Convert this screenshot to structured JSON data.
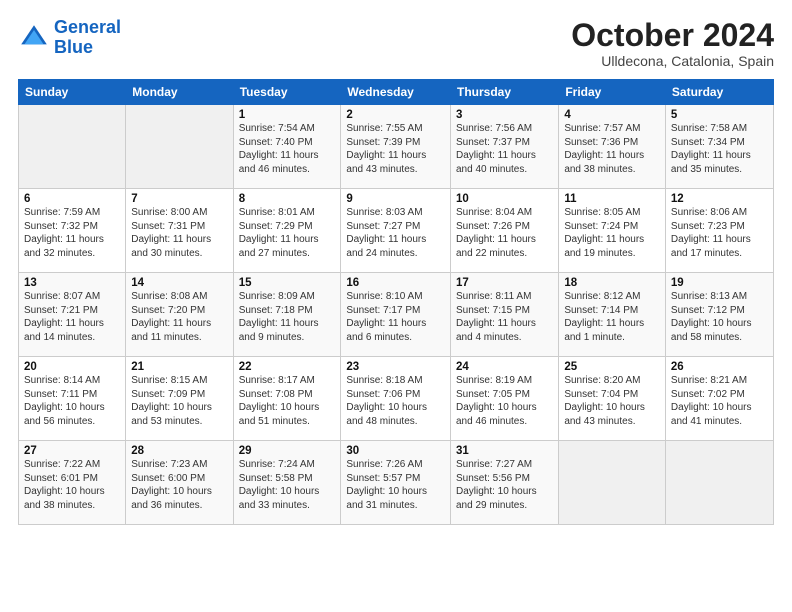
{
  "logo": {
    "line1": "General",
    "line2": "Blue"
  },
  "title": "October 2024",
  "location": "Ulldecona, Catalonia, Spain",
  "days_of_week": [
    "Sunday",
    "Monday",
    "Tuesday",
    "Wednesday",
    "Thursday",
    "Friday",
    "Saturday"
  ],
  "weeks": [
    [
      {
        "num": "",
        "detail": ""
      },
      {
        "num": "",
        "detail": ""
      },
      {
        "num": "1",
        "detail": "Sunrise: 7:54 AM\nSunset: 7:40 PM\nDaylight: 11 hours and 46 minutes."
      },
      {
        "num": "2",
        "detail": "Sunrise: 7:55 AM\nSunset: 7:39 PM\nDaylight: 11 hours and 43 minutes."
      },
      {
        "num": "3",
        "detail": "Sunrise: 7:56 AM\nSunset: 7:37 PM\nDaylight: 11 hours and 40 minutes."
      },
      {
        "num": "4",
        "detail": "Sunrise: 7:57 AM\nSunset: 7:36 PM\nDaylight: 11 hours and 38 minutes."
      },
      {
        "num": "5",
        "detail": "Sunrise: 7:58 AM\nSunset: 7:34 PM\nDaylight: 11 hours and 35 minutes."
      }
    ],
    [
      {
        "num": "6",
        "detail": "Sunrise: 7:59 AM\nSunset: 7:32 PM\nDaylight: 11 hours and 32 minutes."
      },
      {
        "num": "7",
        "detail": "Sunrise: 8:00 AM\nSunset: 7:31 PM\nDaylight: 11 hours and 30 minutes."
      },
      {
        "num": "8",
        "detail": "Sunrise: 8:01 AM\nSunset: 7:29 PM\nDaylight: 11 hours and 27 minutes."
      },
      {
        "num": "9",
        "detail": "Sunrise: 8:03 AM\nSunset: 7:27 PM\nDaylight: 11 hours and 24 minutes."
      },
      {
        "num": "10",
        "detail": "Sunrise: 8:04 AM\nSunset: 7:26 PM\nDaylight: 11 hours and 22 minutes."
      },
      {
        "num": "11",
        "detail": "Sunrise: 8:05 AM\nSunset: 7:24 PM\nDaylight: 11 hours and 19 minutes."
      },
      {
        "num": "12",
        "detail": "Sunrise: 8:06 AM\nSunset: 7:23 PM\nDaylight: 11 hours and 17 minutes."
      }
    ],
    [
      {
        "num": "13",
        "detail": "Sunrise: 8:07 AM\nSunset: 7:21 PM\nDaylight: 11 hours and 14 minutes."
      },
      {
        "num": "14",
        "detail": "Sunrise: 8:08 AM\nSunset: 7:20 PM\nDaylight: 11 hours and 11 minutes."
      },
      {
        "num": "15",
        "detail": "Sunrise: 8:09 AM\nSunset: 7:18 PM\nDaylight: 11 hours and 9 minutes."
      },
      {
        "num": "16",
        "detail": "Sunrise: 8:10 AM\nSunset: 7:17 PM\nDaylight: 11 hours and 6 minutes."
      },
      {
        "num": "17",
        "detail": "Sunrise: 8:11 AM\nSunset: 7:15 PM\nDaylight: 11 hours and 4 minutes."
      },
      {
        "num": "18",
        "detail": "Sunrise: 8:12 AM\nSunset: 7:14 PM\nDaylight: 11 hours and 1 minute."
      },
      {
        "num": "19",
        "detail": "Sunrise: 8:13 AM\nSunset: 7:12 PM\nDaylight: 10 hours and 58 minutes."
      }
    ],
    [
      {
        "num": "20",
        "detail": "Sunrise: 8:14 AM\nSunset: 7:11 PM\nDaylight: 10 hours and 56 minutes."
      },
      {
        "num": "21",
        "detail": "Sunrise: 8:15 AM\nSunset: 7:09 PM\nDaylight: 10 hours and 53 minutes."
      },
      {
        "num": "22",
        "detail": "Sunrise: 8:17 AM\nSunset: 7:08 PM\nDaylight: 10 hours and 51 minutes."
      },
      {
        "num": "23",
        "detail": "Sunrise: 8:18 AM\nSunset: 7:06 PM\nDaylight: 10 hours and 48 minutes."
      },
      {
        "num": "24",
        "detail": "Sunrise: 8:19 AM\nSunset: 7:05 PM\nDaylight: 10 hours and 46 minutes."
      },
      {
        "num": "25",
        "detail": "Sunrise: 8:20 AM\nSunset: 7:04 PM\nDaylight: 10 hours and 43 minutes."
      },
      {
        "num": "26",
        "detail": "Sunrise: 8:21 AM\nSunset: 7:02 PM\nDaylight: 10 hours and 41 minutes."
      }
    ],
    [
      {
        "num": "27",
        "detail": "Sunrise: 7:22 AM\nSunset: 6:01 PM\nDaylight: 10 hours and 38 minutes."
      },
      {
        "num": "28",
        "detail": "Sunrise: 7:23 AM\nSunset: 6:00 PM\nDaylight: 10 hours and 36 minutes."
      },
      {
        "num": "29",
        "detail": "Sunrise: 7:24 AM\nSunset: 5:58 PM\nDaylight: 10 hours and 33 minutes."
      },
      {
        "num": "30",
        "detail": "Sunrise: 7:26 AM\nSunset: 5:57 PM\nDaylight: 10 hours and 31 minutes."
      },
      {
        "num": "31",
        "detail": "Sunrise: 7:27 AM\nSunset: 5:56 PM\nDaylight: 10 hours and 29 minutes."
      },
      {
        "num": "",
        "detail": ""
      },
      {
        "num": "",
        "detail": ""
      }
    ]
  ]
}
